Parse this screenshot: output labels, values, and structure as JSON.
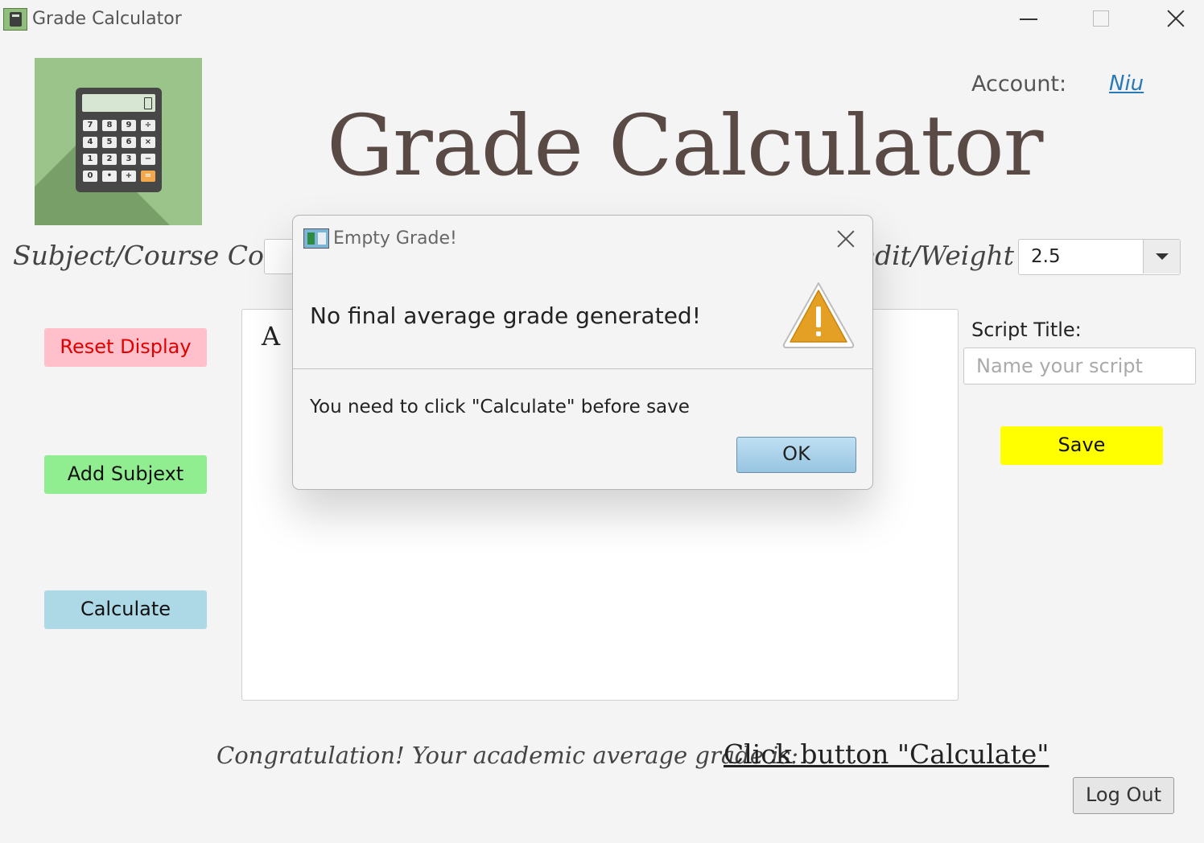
{
  "window": {
    "title": "Grade Calculator"
  },
  "header": {
    "title": "Grade Calculator",
    "account_label": "Account:",
    "account_user": "Niu"
  },
  "logo": {
    "keys": [
      "7",
      "8",
      "9",
      "÷",
      "4",
      "5",
      "6",
      "×",
      "1",
      "2",
      "3",
      "−",
      "0",
      "•",
      "+",
      "="
    ]
  },
  "form": {
    "subject_label": "Subject/Course Code:",
    "subject_value": "",
    "weight_label": "Credit/Weight:",
    "weight_value": "2.5"
  },
  "buttons": {
    "reset": "Reset Display",
    "add": "Add Subjext",
    "calculate": "Calculate",
    "save": "Save",
    "logout": "Log Out"
  },
  "display": {
    "visible_text": "A"
  },
  "script": {
    "label": "Script Title:",
    "placeholder": "Name your script"
  },
  "footer": {
    "congrats": "Congratulation! Your academic average grade is:",
    "result": "Click button \"Calculate\""
  },
  "dialog": {
    "title": "Empty Grade!",
    "header": "No final average grade generated!",
    "content": "You need to click \"Calculate\" before save",
    "ok_label": "OK"
  },
  "colors": {
    "reset_bg": "#ffc0cb",
    "reset_text": "#e00000",
    "add_bg": "#90ee90",
    "calculate_bg": "#add8e6",
    "save_bg": "#ffff00",
    "link": "#2a7ab8",
    "warning": "#e4a024"
  }
}
